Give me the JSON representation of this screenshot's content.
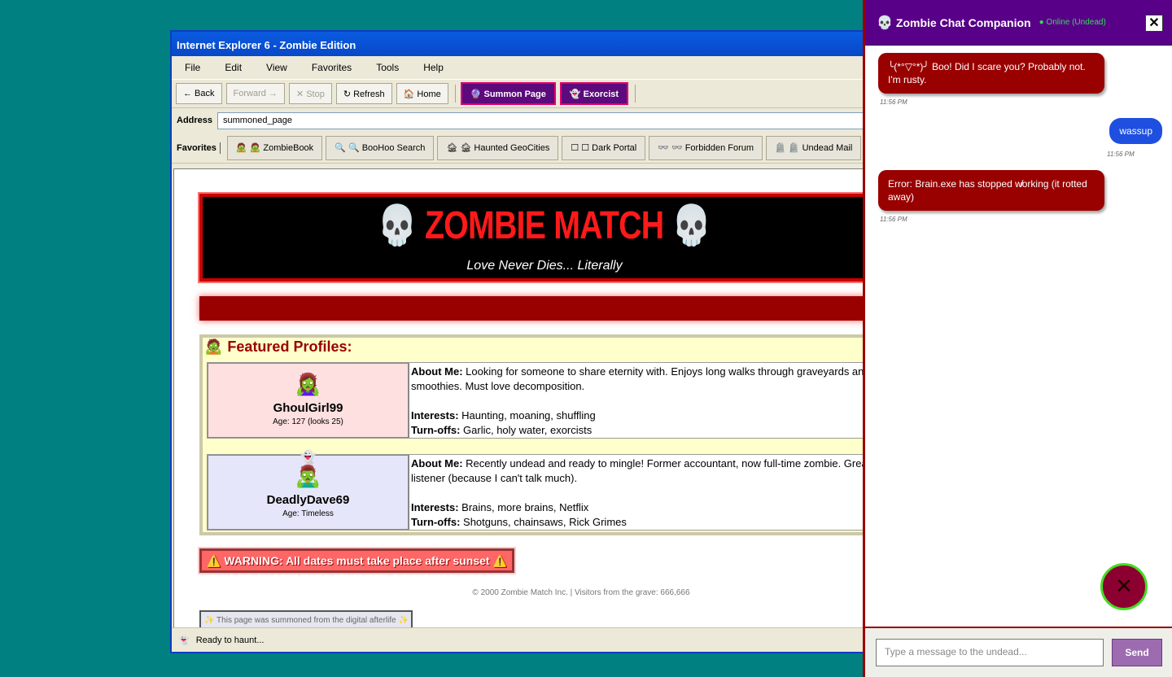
{
  "ie": {
    "title": "Internet Explorer 6 - Zombie Edition",
    "menu": [
      "File",
      "Edit",
      "View",
      "Favorites",
      "Tools",
      "Help"
    ],
    "toolbar": {
      "back": "← Back",
      "forward": "Forward →",
      "stop": "✕ Stop",
      "refresh": "↻ Refresh",
      "home": "🏠 Home",
      "summon": "🔮 Summon Page",
      "exorcist": "👻 Exorcist"
    },
    "address_label": "Address",
    "address_value": "summoned_page",
    "favorites_label": "Favorites",
    "favorites": [
      "🧟 🧟 ZombieBook",
      "🔍 🔍 BooHoo Search",
      "🏚 🏚 Haunted GeoCities",
      "☐ ☐ Dark Portal",
      "👓 👓 Forbidden Forum",
      "🪦 🪦 Undead Mail"
    ],
    "status": "Ready to haunt..."
  },
  "page": {
    "title_text": "ZOMBIE MATCH",
    "skull": "💀",
    "subtitle": "Love Never Dies... Literally",
    "featured_icon": "🧟",
    "featured_heading": "Featured Profiles:",
    "profiles": [
      {
        "avatar": "🧟‍♀️",
        "name": "GhoulGirl99",
        "age": "Age: 127 (looks 25)",
        "about_label": "About Me:",
        "about": "Looking for someone to share eternity with. Enjoys long walks through graveyards and brain smoothies. Must love decomposition.",
        "interests_label": "Interests:",
        "interests": "Haunting, moaning, shuffling",
        "turnoffs_label": "Turn-offs:",
        "turnoffs": "Garlic, holy water, exorcists"
      },
      {
        "avatar": "🧟‍♂️",
        "extra_icon": "👻",
        "name": "DeadlyDave69",
        "age": "Age: Timeless",
        "about_label": "About Me:",
        "about": "Recently undead and ready to mingle! Former accountant, now full-time zombie. Great listener (because I can't talk much).",
        "interests_label": "Interests:",
        "interests": "Brains, more brains, Netflix",
        "turnoffs_label": "Turn-offs:",
        "turnoffs": "Shotguns, chainsaws, Rick Grimes"
      }
    ],
    "warning": "⚠️ WARNING: All dates must take place after sunset ⚠️",
    "copyright": "© 2000 Zombie Match Inc. | Visitors from the grave: 666,666",
    "summoned_note": "✨ This page was summoned from the digital afterlife ✨"
  },
  "chat": {
    "icon": "💀",
    "title": "Zombie Chat Companion",
    "status": "● Online (Undead)",
    "close": "✕",
    "messages": [
      {
        "from": "bot",
        "text": "╰(*°▽°*)╯ Boo! Did I scare you? Probably not. I'm rusty.",
        "time": "11:56 PM"
      },
      {
        "from": "user",
        "text": "wassup",
        "time": "11:56 PM"
      },
      {
        "from": "bot",
        "text": "Error: Brain.exe has stopped w̸orking (it rotted away)",
        "time": "11:56 PM"
      }
    ],
    "fab_icon": "✕",
    "input_placeholder": "Type a message to the undead...",
    "send": "Send"
  },
  "colors": {
    "desktop": "#008080",
    "accent_red": "#990000",
    "chat_header": "#580088",
    "user_bubble": "#1e4fe0"
  }
}
